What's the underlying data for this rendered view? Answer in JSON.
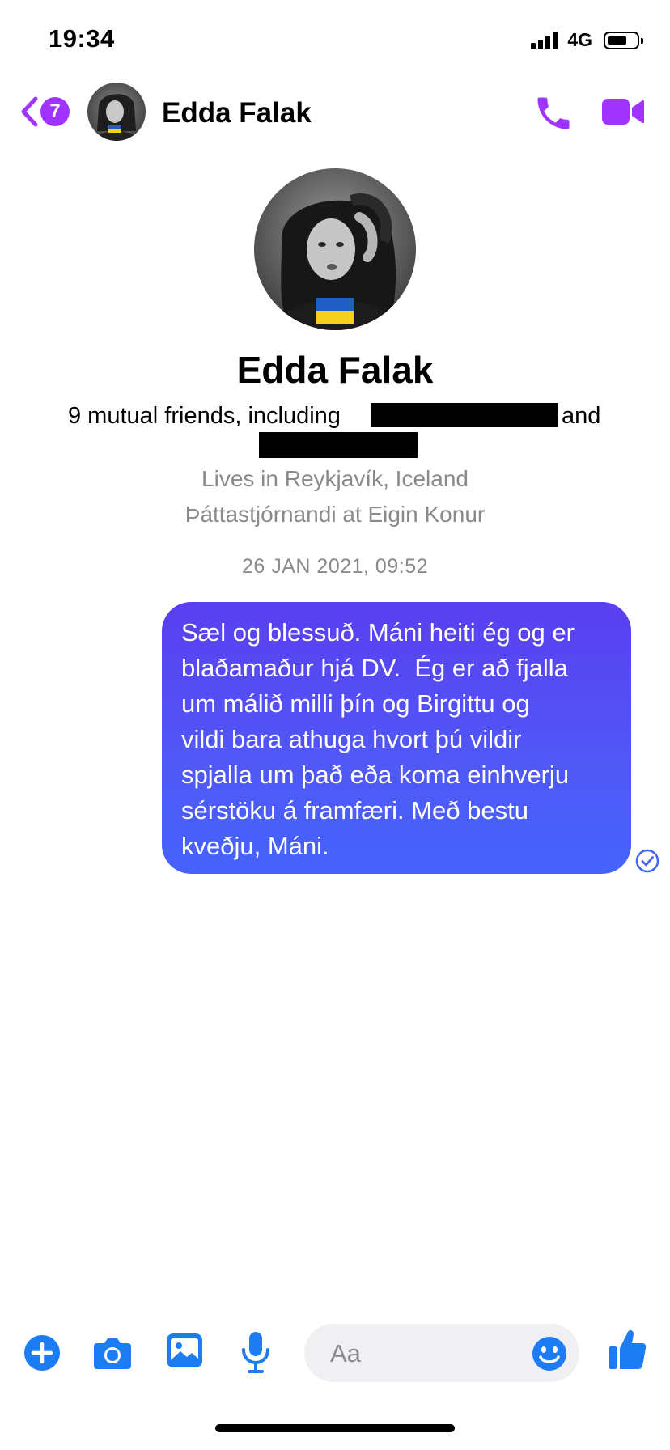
{
  "status_bar": {
    "time": "19:34",
    "network": "4G",
    "battery_level": 0.7
  },
  "header": {
    "unread_count": "7",
    "contact_name": "Edda Falak",
    "icons": [
      "back-chevron-icon",
      "phone-icon",
      "video-camera-icon"
    ],
    "accent_color": "#a033ff"
  },
  "profile": {
    "name": "Edda Falak",
    "mutual_friends_text": "9 mutual friends, including",
    "mutual_friends_and": "and",
    "lives_in": "Lives in Reykjavík, Iceland",
    "works_at": "Þáttastjórnandi at Eigin Konur"
  },
  "conversation": {
    "timestamp": "26 JAN 2021, 09:52",
    "messages": [
      {
        "from": "me",
        "text": "Sæl og blessuð. Máni heiti ég og er\nblaðamaður hjá DV.  Ég er að fjalla\num málið milli þín og Birgittu og\nvildi bara athuga hvort þú vildir\nspjalla um það eða koma einhverju\nsérstöku á framfæri. Með bestu\nkveðju, Máni.",
        "status": "sent",
        "bubble_color": "#5058f6"
      }
    ]
  },
  "composer": {
    "placeholder": "Aa",
    "icons": [
      "plus-icon",
      "camera-icon",
      "photo-gallery-icon",
      "microphone-icon",
      "emoji-icon",
      "thumbs-up-icon"
    ],
    "icon_color": "#1e7cf2"
  }
}
